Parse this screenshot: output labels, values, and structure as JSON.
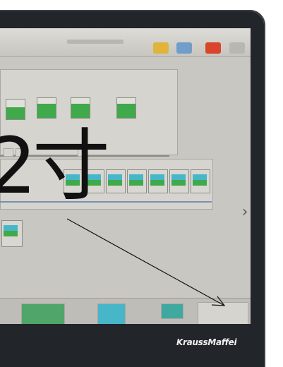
{
  "overlay": {
    "text": "2寸"
  },
  "device": {
    "brand": "KraussMaffei"
  },
  "screen": {
    "nav_arrow": "›"
  },
  "colors": {
    "tank_fill": "#3fa94b",
    "unit_cyan": "#47b6c9",
    "bezel": "#222529",
    "screen_bg": "#c9c7c1",
    "icon_yellow": "#e0b43a",
    "icon_red": "#d8452c"
  },
  "icons": [
    "folder-icon",
    "blue-tool-icon",
    "alarm-icon",
    "menu-icon",
    "chevron-right-icon"
  ]
}
